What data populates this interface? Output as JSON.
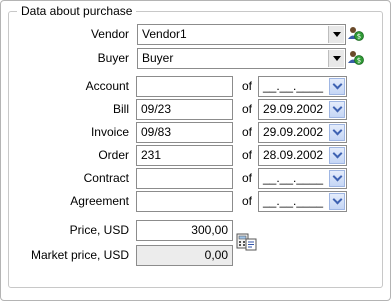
{
  "group": {
    "title": "Data about purchase"
  },
  "vendor": {
    "label": "Vendor",
    "value": "Vendor1",
    "action_icon": "people-money-icon"
  },
  "buyer": {
    "label": "Buyer",
    "value": "Buyer",
    "action_icon": "people-money-icon"
  },
  "of_label": "of",
  "rows": [
    {
      "label": "Account",
      "number": "",
      "date": "__.__.____"
    },
    {
      "label": "Bill",
      "number": "09/23",
      "date": "29.09.2002"
    },
    {
      "label": "Invoice",
      "number": "09/83",
      "date": "29.09.2002"
    },
    {
      "label": "Order",
      "number": "231",
      "date": "28.09.2002"
    },
    {
      "label": "Contract",
      "number": "",
      "date": "__.__.____"
    },
    {
      "label": "Agreement",
      "number": "",
      "date": "__.__.____"
    }
  ],
  "price": {
    "label": "Price, USD",
    "value": "300,00",
    "action_icon": "calculator-copy-icon"
  },
  "market_price": {
    "label": "Market price, USD",
    "value": "0,00"
  }
}
